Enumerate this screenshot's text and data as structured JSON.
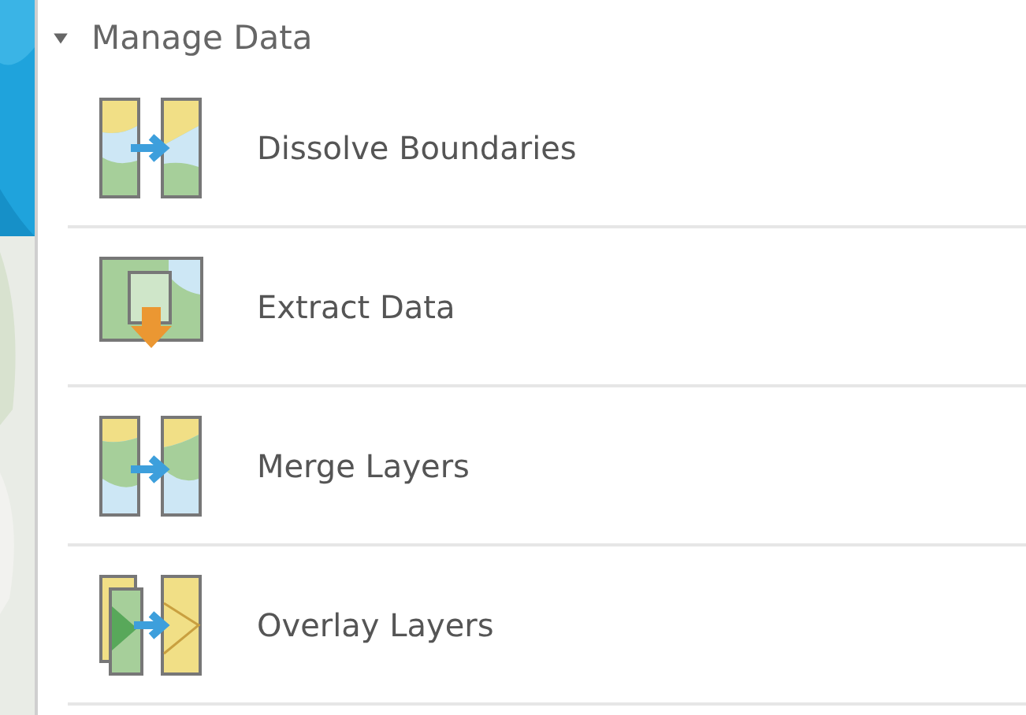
{
  "section": {
    "title": "Manage Data",
    "expanded": true
  },
  "tools": [
    {
      "label": "Dissolve Boundaries",
      "kind": "dissolve"
    },
    {
      "label": "Extract Data",
      "kind": "extract"
    },
    {
      "label": "Merge Layers",
      "kind": "merge"
    },
    {
      "label": "Overlay Layers",
      "kind": "overlay"
    }
  ]
}
